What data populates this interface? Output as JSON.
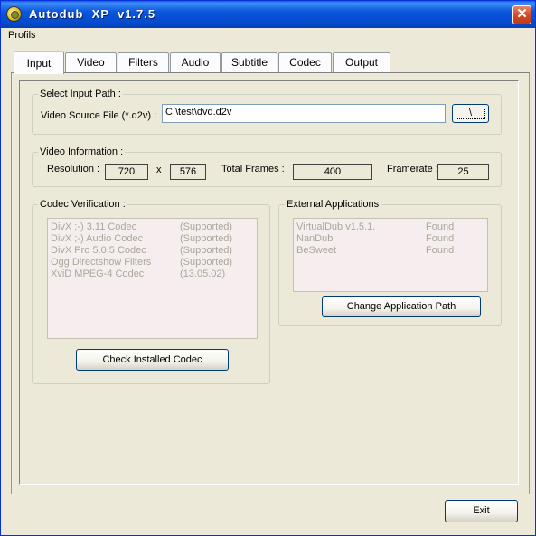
{
  "window": {
    "title": "Autodub  XP  v1.7.5",
    "close_glyph": "✕"
  },
  "menu": {
    "items": [
      "Profils"
    ]
  },
  "tabs": [
    {
      "label": "Input",
      "active": true
    },
    {
      "label": "Video"
    },
    {
      "label": "Filters"
    },
    {
      "label": "Audio"
    },
    {
      "label": "Subtitle"
    },
    {
      "label": "Codec"
    },
    {
      "label": "Output"
    }
  ],
  "input_path": {
    "group_title": "Select Input Path :",
    "field_label": "Video Source File (*.d2v) :",
    "field_value": "C:\\test\\dvd.d2v",
    "browse_label": "\\"
  },
  "video_info": {
    "group_title": "Video Information :",
    "resolution_label": "Resolution :",
    "width": "720",
    "x_sep": "x",
    "height": "576",
    "frames_label": "Total Frames :",
    "frames": "400",
    "framerate_label": "Framerate :",
    "framerate": "25"
  },
  "codec_verification": {
    "group_title": "Codec Verification :",
    "rows": [
      {
        "name": "DivX ;-) 3.11 Codec",
        "status": "(Supported)"
      },
      {
        "name": "DivX ;-) Audio Codec",
        "status": "(Supported)"
      },
      {
        "name": "DivX Pro 5.0.5 Codec",
        "status": "(Supported)"
      },
      {
        "name": "Ogg Directshow Filters",
        "status": "(Supported)"
      },
      {
        "name": "XviD MPEG-4 Codec",
        "status": "(13.05.02)"
      }
    ],
    "button_label": "Check Installed Codec"
  },
  "external_apps": {
    "group_title": "External Applications",
    "rows": [
      {
        "name": "VirtualDub v1.5.1.",
        "status": "Found"
      },
      {
        "name": "NanDub",
        "status": "Found"
      },
      {
        "name": "BeSweet",
        "status": "Found"
      }
    ],
    "button_label": "Change Application Path"
  },
  "footer": {
    "exit_label": "Exit"
  },
  "colors": {
    "titlebar": "#0a56dd",
    "window_bg": "#ece9d8",
    "tab_highlight": "#ffc83c",
    "disabled_text": "#a8a89a",
    "list_bg": "#f6eeee"
  }
}
